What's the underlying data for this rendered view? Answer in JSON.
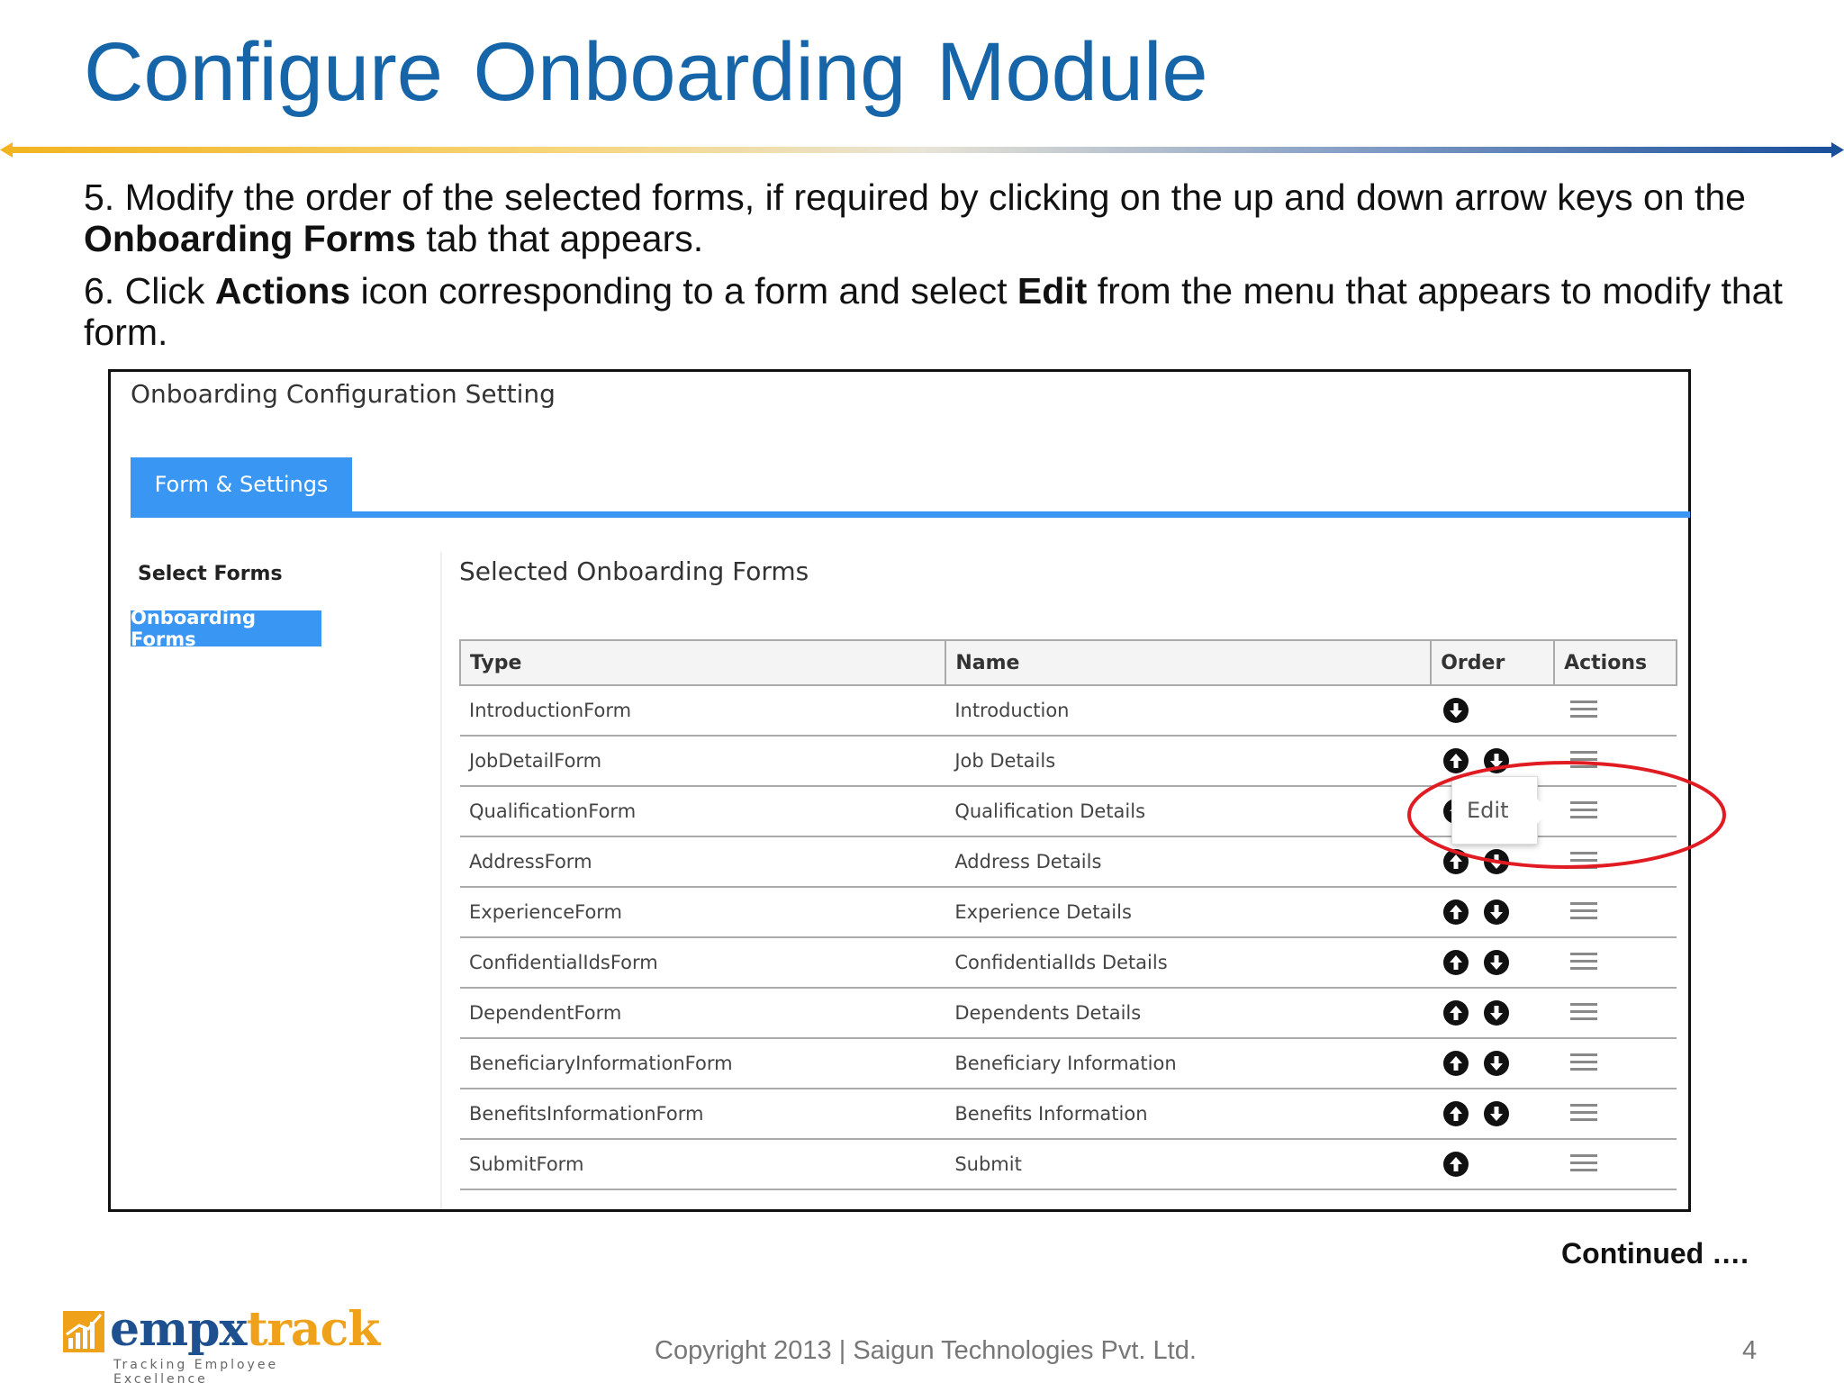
{
  "slide": {
    "title": "Configure Onboarding Module",
    "step5": {
      "prefix": "5. Modify the order of the selected forms, if required by clicking on the up and down arrow keys on the ",
      "bold": "Onboarding Forms",
      "suffix": " tab that appears."
    },
    "step6": {
      "prefix": "6. Click ",
      "bold1": "Actions",
      "middle": " icon corresponding to a form and select ",
      "bold2": "Edit",
      "suffix": " from the menu that appears to modify that form."
    },
    "continued": "Continued ….",
    "copyright": "Copyright 2013 | Saigun Technologies Pvt. Ltd.",
    "page_number": "4"
  },
  "screenshot": {
    "title": "Onboarding Configuration Setting",
    "tab_label": "Form & Settings",
    "sidebar": {
      "heading": "Select Forms",
      "active_item": "Onboarding Forms"
    },
    "section_title": "Selected Onboarding Forms",
    "table": {
      "headers": [
        "Type",
        "Name",
        "Order",
        "Actions"
      ],
      "rows": [
        {
          "type": "IntroductionForm",
          "name": "Introduction",
          "up": false,
          "down": true
        },
        {
          "type": "JobDetailForm",
          "name": "Job Details",
          "up": true,
          "down": true
        },
        {
          "type": "QualificationForm",
          "name": "Qualification Details",
          "up": true,
          "down": true
        },
        {
          "type": "AddressForm",
          "name": "Address Details",
          "up": true,
          "down": true
        },
        {
          "type": "ExperienceForm",
          "name": "Experience Details",
          "up": true,
          "down": true
        },
        {
          "type": "ConfidentialIdsForm",
          "name": "ConfidentialIds Details",
          "up": true,
          "down": true
        },
        {
          "type": "DependentForm",
          "name": "Dependents Details",
          "up": true,
          "down": true
        },
        {
          "type": "BeneficiaryInformationForm",
          "name": "Beneficiary Information",
          "up": true,
          "down": true
        },
        {
          "type": "BenefitsInformationForm",
          "name": "Benefits Information",
          "up": true,
          "down": true
        },
        {
          "type": "SubmitForm",
          "name": "Submit",
          "up": true,
          "down": false
        }
      ]
    },
    "popover_label": "Edit",
    "highlight_color": "#e11b22"
  },
  "logo": {
    "word_part1": "empx",
    "word_part2": "track",
    "tagline": "Tracking Employee Excellence"
  },
  "colors": {
    "title_blue": "#1565a8",
    "tab_blue": "#3a96f3",
    "logo_blue": "#1e4f8f",
    "logo_orange": "#f0a11a"
  }
}
